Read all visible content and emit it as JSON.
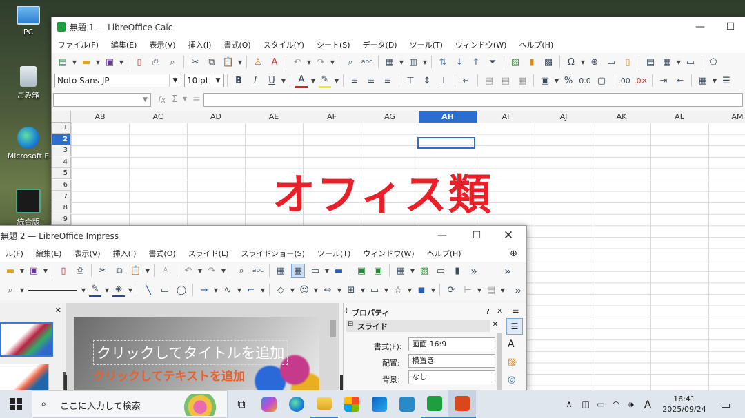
{
  "desktop": {
    "icons": [
      {
        "label": "PC"
      },
      {
        "label": "ごみ箱"
      },
      {
        "label": "Microsoft E"
      },
      {
        "label": "統合版"
      }
    ]
  },
  "calc": {
    "title": "無題 1 — LibreOffice Calc",
    "menu": [
      "ファイル(F)",
      "編集(E)",
      "表示(V)",
      "挿入(I)",
      "書式(O)",
      "スタイル(Y)",
      "シート(S)",
      "データ(D)",
      "ツール(T)",
      "ウィンドウ(W)",
      "ヘルプ(H)"
    ],
    "font_name": "Noto Sans JP",
    "font_size": "10 pt",
    "fx_label": "fx",
    "sigma_label": "Σ",
    "equals_label": "=",
    "columns": [
      "AB",
      "AC",
      "AD",
      "AE",
      "AF",
      "AG",
      "AH",
      "AI",
      "AJ",
      "AK",
      "AL",
      "AM"
    ],
    "active_column": "AH",
    "rows": [
      "1",
      "2",
      "3",
      "4",
      "5",
      "6",
      "7",
      "8",
      "9"
    ],
    "active_row": "2",
    "overlay_text": "オフィス類",
    "accent_color": "#e8202a"
  },
  "impress": {
    "title": "無題 2 — LibreOffice Impress",
    "menu": [
      "ル(F)",
      "編集(E)",
      "表示(V)",
      "挿入(I)",
      "書式(O)",
      "スライド(L)",
      "スライドショー(S)",
      "ツール(T)",
      "ウィンドウ(W)",
      "ヘルプ(H)"
    ],
    "properties_title": "プロパティ",
    "slide_section": "スライド",
    "format_label": "書式(F):",
    "format_value": "画面 16:9",
    "orientation_label": "配置:",
    "orientation_value": "横置き",
    "background_label": "背景:",
    "background_value": "なし",
    "slide_title_placeholder": "クリックしてタイトルを追加",
    "slide_text_placeholder": "クリックしてテキストを追加",
    "help_label": "?"
  },
  "taskbar": {
    "search_placeholder": "ここに入力して検索",
    "ime_label": "A",
    "time": "16:41",
    "date": "2025/09/24"
  }
}
